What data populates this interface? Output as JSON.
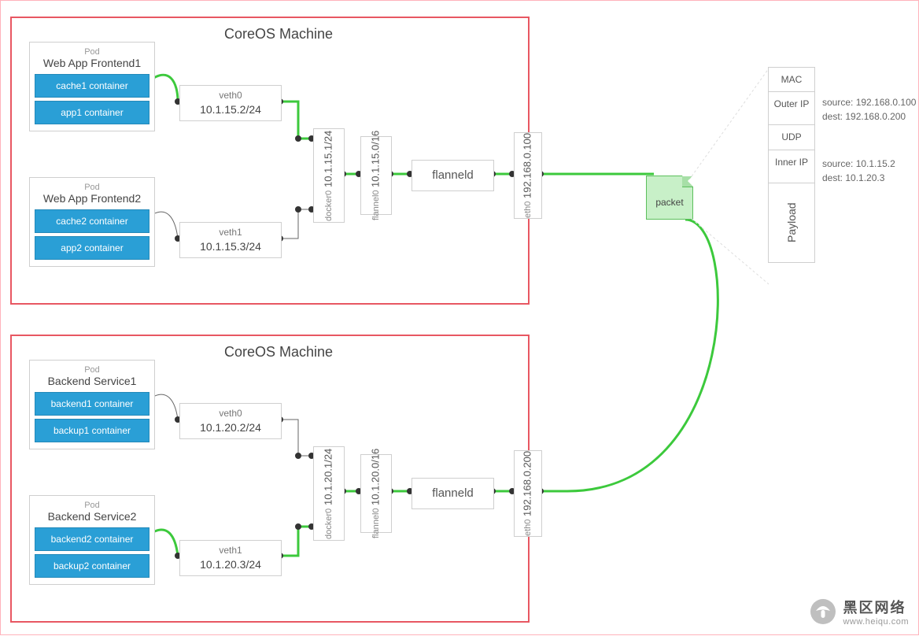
{
  "watermark": {
    "title": "黑区网络",
    "url": "www.heiqu.com"
  },
  "machines": [
    {
      "title": "CoreOS Machine",
      "pods": [
        {
          "label": "Pod",
          "name": "Web App Frontend1",
          "containers": [
            "cache1 container",
            "app1 container"
          ]
        },
        {
          "label": "Pod",
          "name": "Web App Frontend2",
          "containers": [
            "cache2 container",
            "app2 container"
          ]
        }
      ],
      "veths": [
        {
          "name": "veth0",
          "ip": "10.1.15.2/24"
        },
        {
          "name": "veth1",
          "ip": "10.1.15.3/24"
        }
      ],
      "docker0": {
        "name": "docker0",
        "ip": "10.1.15.1/24"
      },
      "flannel0": {
        "name": "flannel0",
        "ip": "10.1.15.0/16"
      },
      "flanneld": "flanneld",
      "eth0": {
        "name": "eth0",
        "ip": "192.168.0.100"
      }
    },
    {
      "title": "CoreOS Machine",
      "pods": [
        {
          "label": "Pod",
          "name": "Backend Service1",
          "containers": [
            "backend1 container",
            "backup1 container"
          ]
        },
        {
          "label": "Pod",
          "name": "Backend Service2",
          "containers": [
            "backend2 container",
            "backup2 container"
          ]
        }
      ],
      "veths": [
        {
          "name": "veth0",
          "ip": "10.1.20.2/24"
        },
        {
          "name": "veth1",
          "ip": "10.1.20.3/24"
        }
      ],
      "docker0": {
        "name": "docker0",
        "ip": "10.1.20.1/24"
      },
      "flannel0": {
        "name": "flannel0",
        "ip": "10.1.20.0/16"
      },
      "flanneld": "flanneld",
      "eth0": {
        "name": "eth0",
        "ip": "192.168.0.200"
      }
    }
  ],
  "packet": {
    "label": "packet",
    "headers": {
      "mac": "MAC",
      "outer_ip": "Outer IP",
      "udp": "UDP",
      "inner_ip": "Inner IP",
      "payload": "Payload"
    },
    "outer": {
      "source_label": "source:",
      "source": "192.168.0.100",
      "dest_label": "dest:",
      "dest": "192.168.0.200"
    },
    "inner": {
      "source_label": "source:",
      "source": "10.1.15.2",
      "dest_label": "dest:",
      "dest": "10.1.20.3"
    }
  },
  "chart_data": {
    "type": "diagram",
    "title": "Flannel overlay network across two CoreOS machines",
    "nodes": [
      {
        "id": "m1",
        "label": "CoreOS Machine"
      },
      {
        "id": "m1.pod1",
        "label": "Pod: Web App Frontend1",
        "containers": [
          "cache1 container",
          "app1 container"
        ]
      },
      {
        "id": "m1.pod2",
        "label": "Pod: Web App Frontend2",
        "containers": [
          "cache2 container",
          "app2 container"
        ]
      },
      {
        "id": "m1.veth0",
        "label": "veth0 10.1.15.2/24"
      },
      {
        "id": "m1.veth1",
        "label": "veth1 10.1.15.3/24"
      },
      {
        "id": "m1.docker0",
        "label": "docker0 10.1.15.1/24"
      },
      {
        "id": "m1.flannel0",
        "label": "flannel0 10.1.15.0/16"
      },
      {
        "id": "m1.flanneld",
        "label": "flanneld"
      },
      {
        "id": "m1.eth0",
        "label": "eth0 192.168.0.100"
      },
      {
        "id": "m2",
        "label": "CoreOS Machine"
      },
      {
        "id": "m2.pod1",
        "label": "Pod: Backend Service1",
        "containers": [
          "backend1 container",
          "backup1 container"
        ]
      },
      {
        "id": "m2.pod2",
        "label": "Pod: Backend Service2",
        "containers": [
          "backend2 container",
          "backup2 container"
        ]
      },
      {
        "id": "m2.veth0",
        "label": "veth0 10.1.20.2/24"
      },
      {
        "id": "m2.veth1",
        "label": "veth1 10.1.20.3/24"
      },
      {
        "id": "m2.docker0",
        "label": "docker0 10.1.20.1/24"
      },
      {
        "id": "m2.flannel0",
        "label": "flannel0 10.1.20.0/16"
      },
      {
        "id": "m2.flanneld",
        "label": "flanneld"
      },
      {
        "id": "m2.eth0",
        "label": "eth0 192.168.0.200"
      },
      {
        "id": "packet",
        "label": "packet",
        "outer_ip": {
          "source": "192.168.0.100",
          "dest": "192.168.0.200"
        },
        "inner_ip": {
          "source": "10.1.15.2",
          "dest": "10.1.20.3"
        },
        "layers": [
          "MAC",
          "Outer IP",
          "UDP",
          "Inner IP",
          "Payload"
        ]
      }
    ],
    "edges_highlighted": [
      [
        "m1.pod1",
        "m1.veth0"
      ],
      [
        "m1.veth0",
        "m1.docker0"
      ],
      [
        "m1.docker0",
        "m1.flannel0"
      ],
      [
        "m1.flannel0",
        "m1.flanneld"
      ],
      [
        "m1.flanneld",
        "m1.eth0"
      ],
      [
        "m1.eth0",
        "packet"
      ],
      [
        "packet",
        "m2.eth0"
      ],
      [
        "m2.eth0",
        "m2.flanneld"
      ],
      [
        "m2.flanneld",
        "m2.flannel0"
      ],
      [
        "m2.flannel0",
        "m2.docker0"
      ],
      [
        "m2.docker0",
        "m2.veth1"
      ],
      [
        "m2.veth1",
        "m2.pod2"
      ]
    ],
    "edges_other": [
      [
        "m1.pod2",
        "m1.veth1"
      ],
      [
        "m1.veth1",
        "m1.docker0"
      ],
      [
        "m2.pod1",
        "m2.veth0"
      ],
      [
        "m2.veth0",
        "m2.docker0"
      ]
    ]
  }
}
